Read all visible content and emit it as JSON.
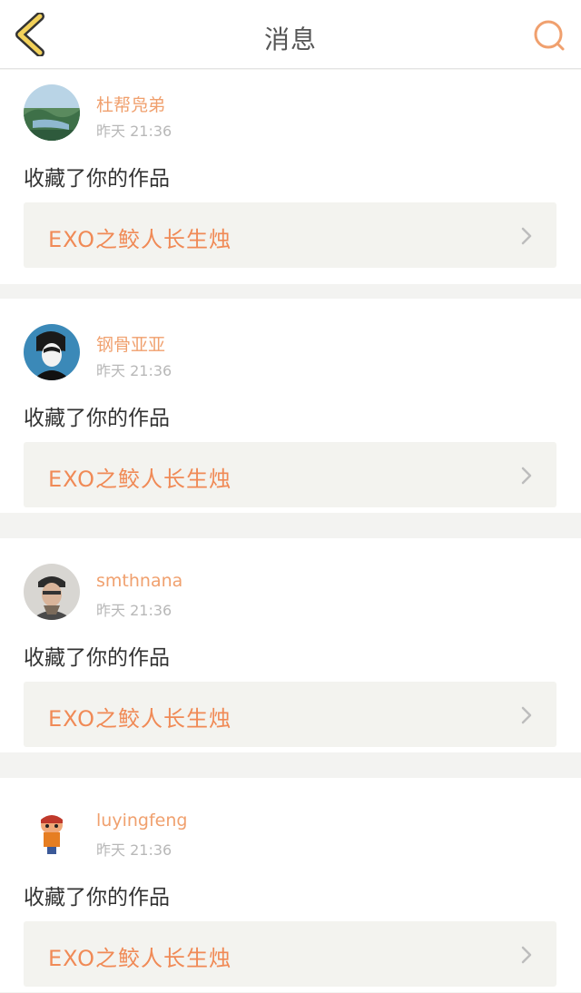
{
  "header": {
    "title": "消息",
    "back_icon": "chevron-left-icon",
    "search_icon": "search-icon",
    "accent": "#f0a06e"
  },
  "messages": [
    {
      "username": "杜帮凫弟",
      "time": "昨天 21:36",
      "action": "收藏了你的作品",
      "work_title": "EXO之鲛人长生烛",
      "avatar": "landscape-avatar"
    },
    {
      "username": "钢骨亚亚",
      "time": "昨天 21:36",
      "action": "收藏了你的作品",
      "work_title": "EXO之鲛人长生烛",
      "avatar": "portrait-avatar"
    },
    {
      "username": "smthnana",
      "time": "昨天 21:36",
      "action": "收藏了你的作品",
      "work_title": "EXO之鲛人长生烛",
      "avatar": "photo-avatar"
    },
    {
      "username": "luyingfeng",
      "time": "昨天 21:36",
      "action": "收藏了你的作品",
      "work_title": "EXO之鲛人长生烛",
      "avatar": "cartoon-avatar"
    }
  ]
}
